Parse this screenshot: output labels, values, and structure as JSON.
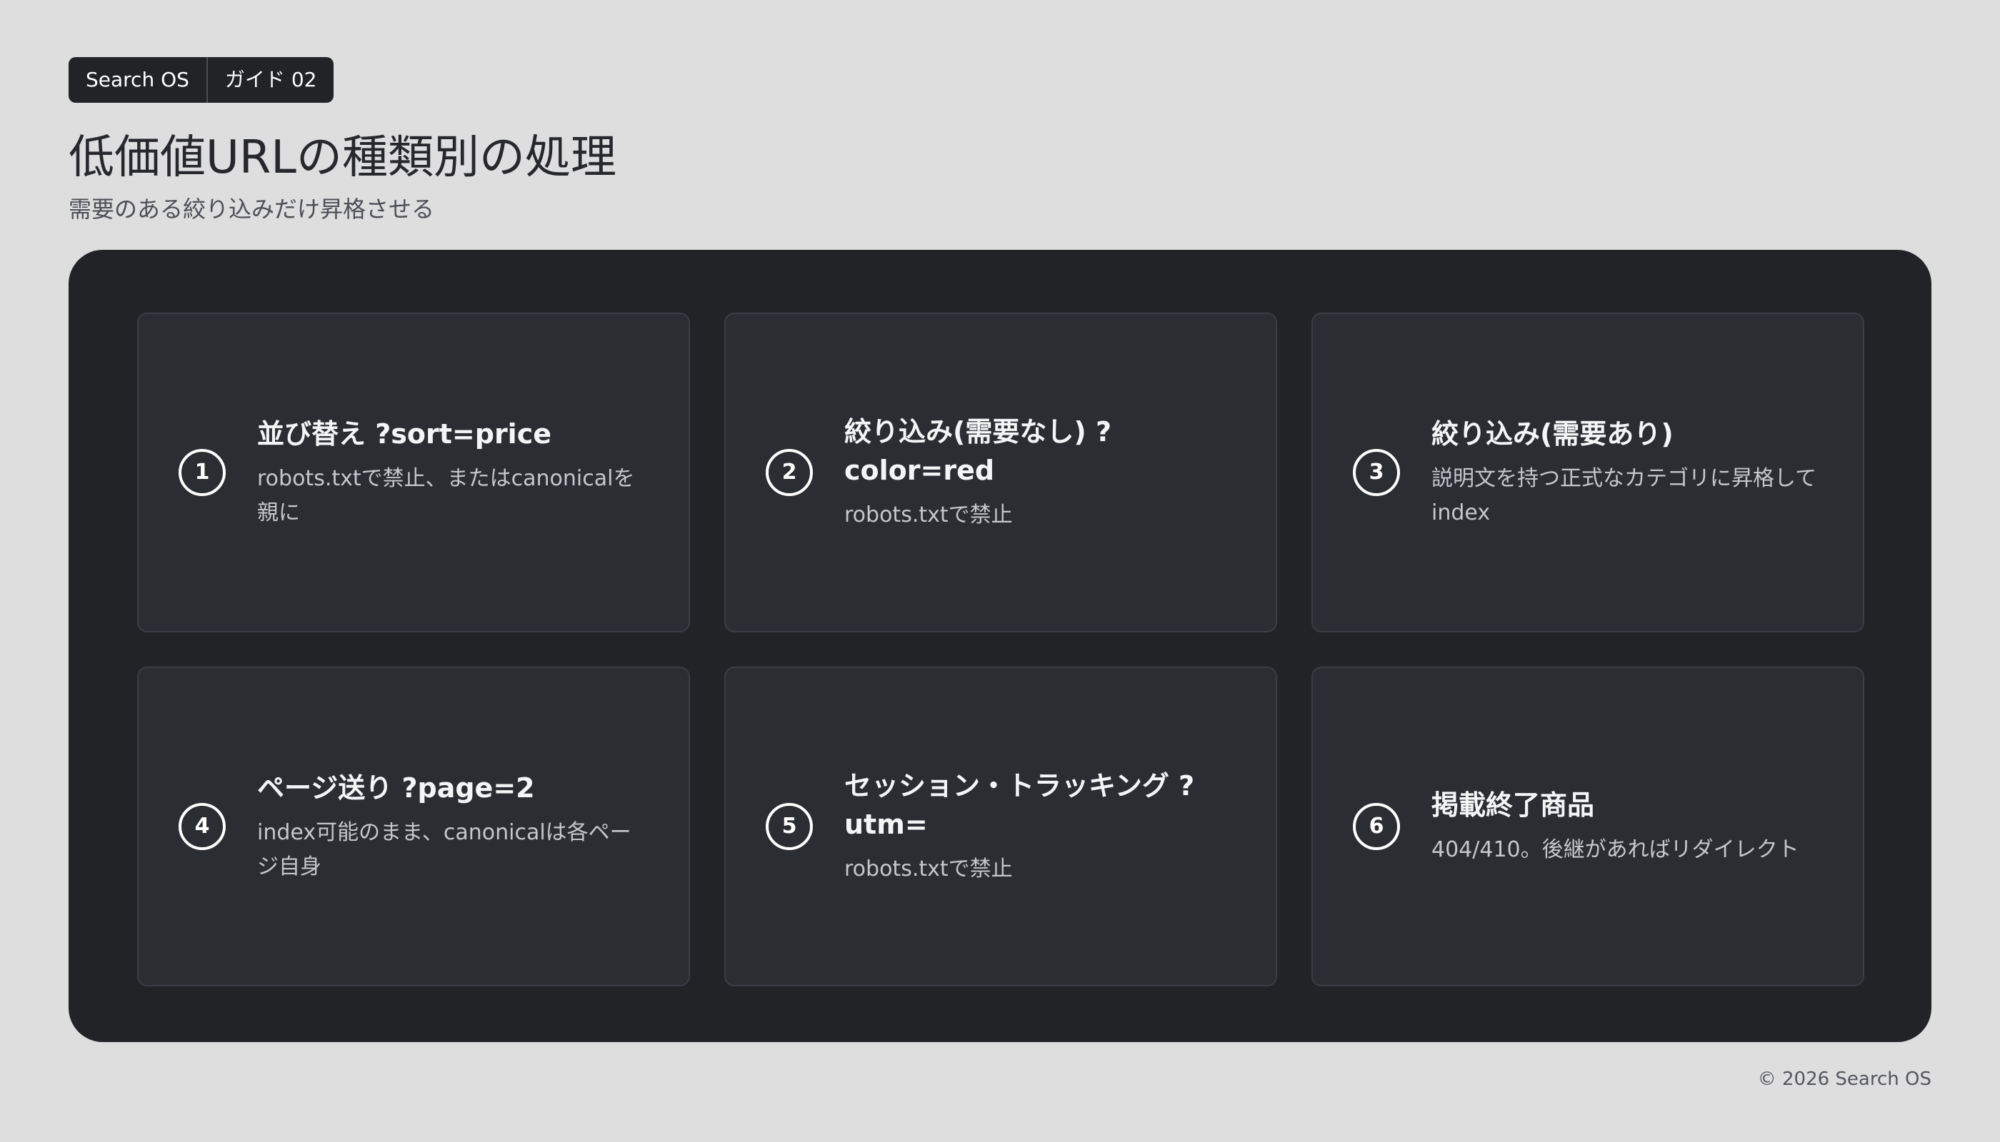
{
  "badge": {
    "brand": "Search OS",
    "label": "ガイド 02"
  },
  "header": {
    "title": "低価値URLの種類別の処理",
    "subtitle": "需要のある絞り込みだけ昇格させる"
  },
  "cards": [
    {
      "number": "1",
      "title": "並び替え ?sort=price",
      "description": "robots.txtで禁止、またはcanonicalを親に"
    },
    {
      "number": "2",
      "title": "絞り込み(需要なし) ?color=red",
      "description": "robots.txtで禁止"
    },
    {
      "number": "3",
      "title": "絞り込み(需要あり)",
      "description": "説明文を持つ正式なカテゴリに昇格してindex"
    },
    {
      "number": "4",
      "title": "ページ送り ?page=2",
      "description": "index可能のまま、canonicalは各ページ自身"
    },
    {
      "number": "5",
      "title": "セッション・トラッキング ?utm=",
      "description": "robots.txtで禁止"
    },
    {
      "number": "6",
      "title": "掲載終了商品",
      "description": "404/410。後継があればリダイレクト"
    }
  ],
  "footer": {
    "copyright": "© 2026 Search OS"
  }
}
